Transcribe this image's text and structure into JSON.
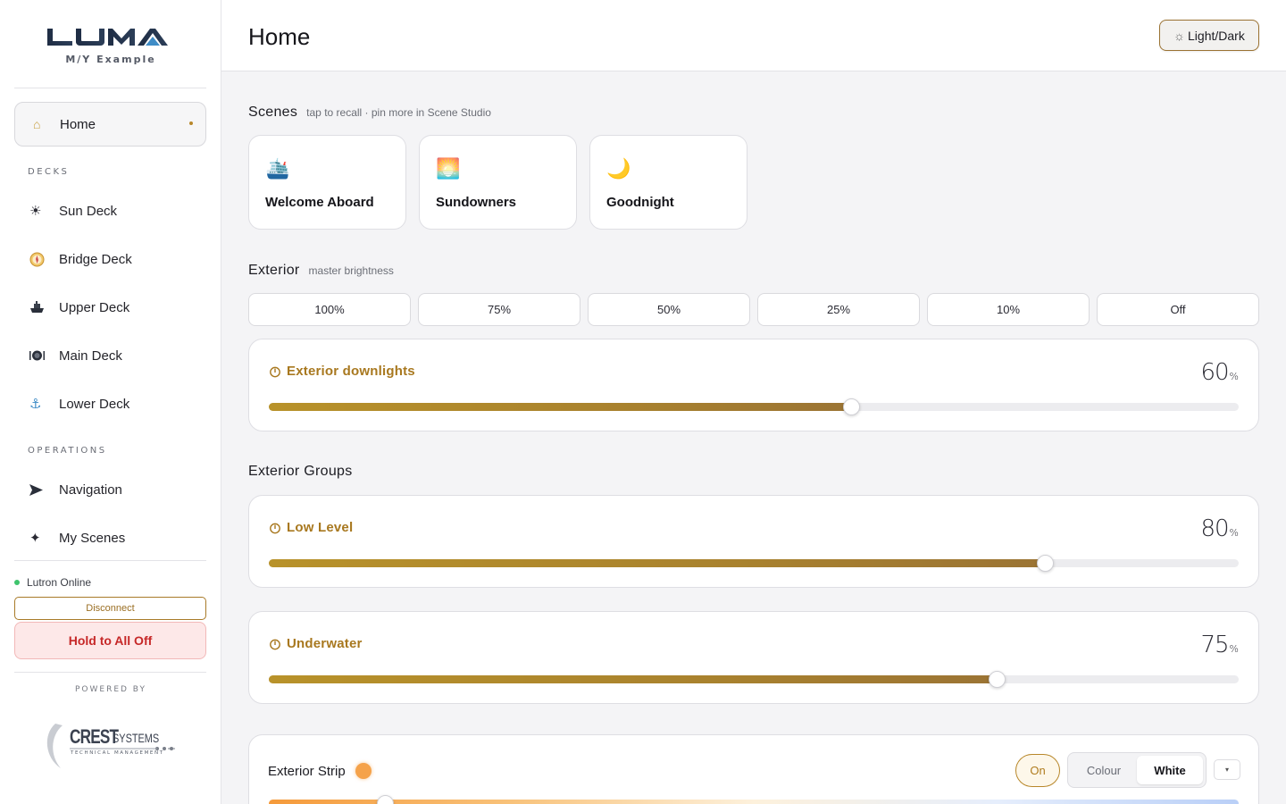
{
  "sidebar": {
    "logo_text": "LUMA",
    "vessel": "M/Y Example",
    "home": {
      "label": "Home",
      "icon": "home-icon"
    },
    "decks_label": "DECKS",
    "decks": [
      {
        "label": "Sun Deck",
        "icon": "sun-icon"
      },
      {
        "label": "Bridge Deck",
        "icon": "compass-icon"
      },
      {
        "label": "Upper Deck",
        "icon": "ship-icon"
      },
      {
        "label": "Main Deck",
        "icon": "dining-icon"
      },
      {
        "label": "Lower Deck",
        "icon": "anchor-icon"
      }
    ],
    "operations_label": "OPERATIONS",
    "operations": [
      {
        "label": "Navigation",
        "icon": "navigation-arrow-icon"
      },
      {
        "label": "My Scenes",
        "icon": "sparkle-icon"
      }
    ],
    "status_text": "Lutron Online",
    "disconnect_label": "Disconnect",
    "all_off_label": "Hold to All Off",
    "powered_by": "POWERED BY",
    "partner_logo": {
      "name": "CREST",
      "suffix": "SYSTEMS",
      "tagline": "TECHNICAL MANAGEMENT"
    }
  },
  "header": {
    "title": "Home",
    "theme_label": "Light/Dark",
    "theme_icon": "sun-outline-icon"
  },
  "scenes": {
    "title": "Scenes",
    "hint": "tap to recall · pin more in Scene Studio",
    "items": [
      {
        "label": "Welcome Aboard",
        "emoji": "🛳️"
      },
      {
        "label": "Sundowners",
        "emoji": "🌅"
      },
      {
        "label": "Goodnight",
        "emoji": "🌙"
      }
    ]
  },
  "exterior": {
    "title": "Exterior",
    "hint": "master brightness",
    "presets": [
      "100%",
      "75%",
      "50%",
      "25%",
      "10%",
      "Off"
    ],
    "master": {
      "name": "Exterior downlights",
      "value": 60,
      "unit": "%"
    }
  },
  "groups": {
    "title": "Exterior Groups",
    "items": [
      {
        "name": "Low Level",
        "value": 80,
        "unit": "%"
      },
      {
        "name": "Underwater",
        "value": 75,
        "unit": "%"
      }
    ]
  },
  "strip": {
    "name": "Exterior Strip",
    "on_label": "On",
    "modes": [
      "Colour",
      "White"
    ],
    "active_mode": "White",
    "more_icon": "▾",
    "swatch_color": "#f5a24a",
    "level": 0.12
  },
  "colors": {
    "accent": "#a8781f",
    "danger": "#c62828",
    "online": "#3ec46d"
  }
}
